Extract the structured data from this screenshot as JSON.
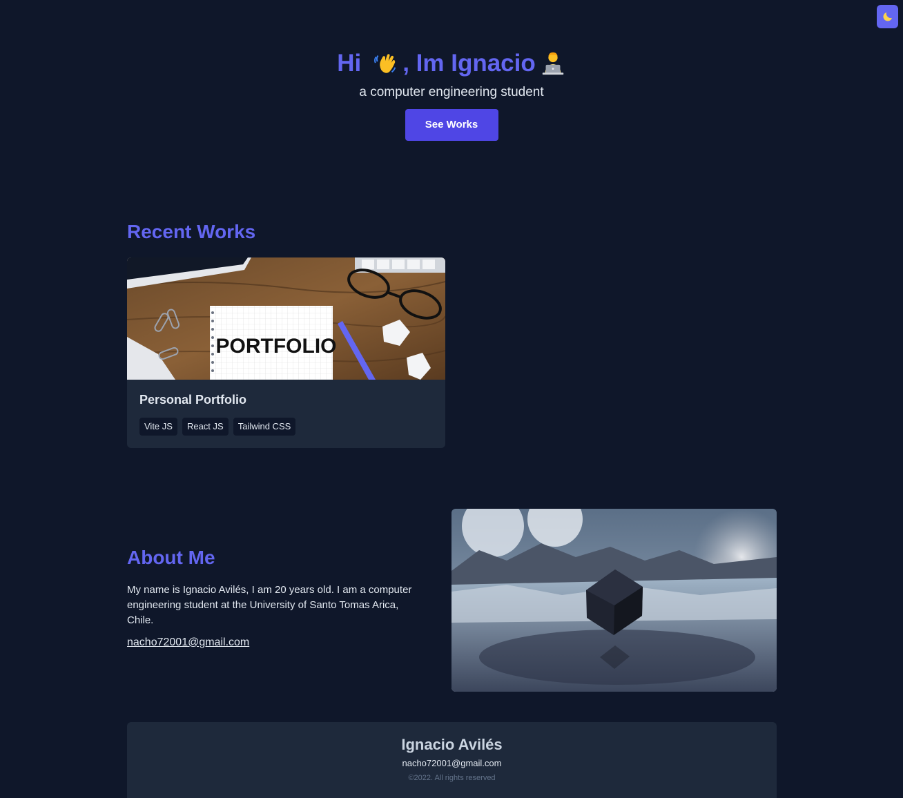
{
  "theme_toggle": {
    "icon": "moon-icon"
  },
  "hero": {
    "greeting": "Hi",
    "name_part": ", Im Ignacio",
    "subtitle": "a computer engineering student",
    "button_label": "See Works",
    "wave_icon": "waving-hand-icon",
    "laptop_icon": "technologist-icon"
  },
  "recent_works": {
    "title": "Recent Works",
    "projects": [
      {
        "title": "Personal Portfolio",
        "image_text": "PORTFOLIO",
        "tags": [
          "Vite JS",
          "React JS",
          "Tailwind CSS"
        ]
      }
    ]
  },
  "about": {
    "title": "About Me",
    "description": "My name is Ignacio Avilés, I am 20 years old. I am a computer engineering student at the University of Santo Tomas Arica, Chile.",
    "email": "nacho72001@gmail.com"
  },
  "footer": {
    "name": "Ignacio Avilés",
    "email": "nacho72001@gmail.com",
    "copyright": "©2022. All rights reserved"
  },
  "colors": {
    "background": "#0f172a",
    "surface": "#1e293b",
    "accent": "#6366f1",
    "button": "#4f46e5"
  }
}
